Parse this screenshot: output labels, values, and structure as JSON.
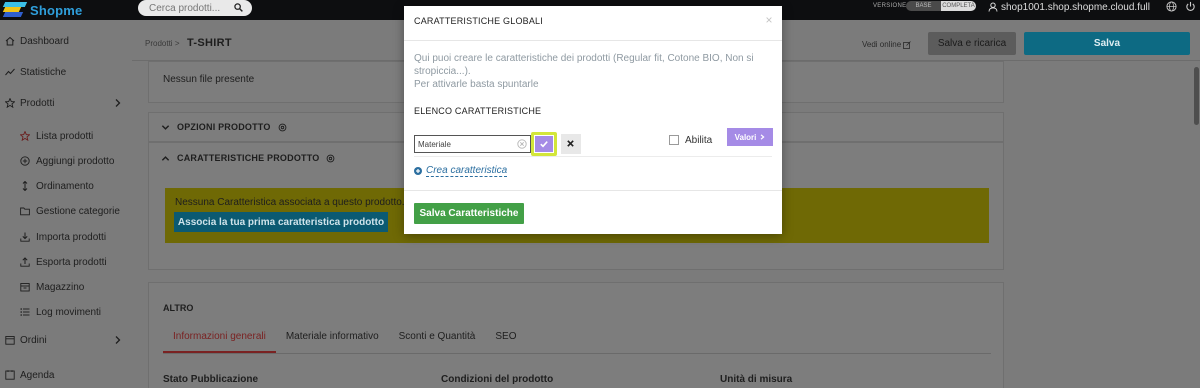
{
  "topbar": {
    "logo_text": "Shopme",
    "search_placeholder": "Cerca prodotti...",
    "version_label": "VERSIONE",
    "version_base": "BASE",
    "version_full": "COMPLETA",
    "shop_domain": "shop1001.shop.shopme.cloud.full"
  },
  "sidebar": {
    "items": [
      {
        "label": "Dashboard",
        "icon": "home-icon"
      },
      {
        "label": "Statistiche",
        "icon": "chart-line-icon"
      },
      {
        "label": "Prodotti",
        "icon": "star-icon",
        "expanded": true
      },
      {
        "label": "Lista prodotti",
        "icon": "star-outline-icon",
        "active": true
      },
      {
        "label": "Aggiungi prodotto",
        "icon": "plus-circle-icon"
      },
      {
        "label": "Ordinamento",
        "icon": "sort-arrows-icon"
      },
      {
        "label": "Gestione categorie",
        "icon": "folder-icon"
      },
      {
        "label": "Importa prodotti",
        "icon": "download-icon"
      },
      {
        "label": "Esporta prodotti",
        "icon": "upload-icon"
      },
      {
        "label": "Magazzino",
        "icon": "warehouse-icon"
      },
      {
        "label": "Log movimenti",
        "icon": "list-icon"
      },
      {
        "label": "Ordini",
        "icon": "calendar-icon"
      },
      {
        "label": "Agenda",
        "icon": "agenda-icon"
      }
    ]
  },
  "header": {
    "breadcrumb_root": "Prodotti",
    "breadcrumb_sep": ">",
    "title": "T-SHIRT",
    "view_online": "Vedi online",
    "save_reload": "Salva e ricarica",
    "save": "Salva"
  },
  "content": {
    "no_files": "Nessun file presente",
    "options_section": "OPZIONI PRODOTTO",
    "features_section": "CARATTERISTICHE PRODOTTO",
    "no_features_text": "Nessuna Caratteristica associata a questo prodotto.",
    "associate_button": "Associa la tua prima caratteristica prodotto",
    "other_title": "ALTRO",
    "tabs": [
      "Informazioni generali",
      "Materiale informativo",
      "Sconti e Quantità",
      "SEO"
    ],
    "field_labels": [
      "Stato Pubblicazione",
      "Condizioni del prodotto",
      "Unità di misura"
    ]
  },
  "modal": {
    "title": "CARATTERISTICHE GLOBALI",
    "close": "×",
    "desc_line1": "Qui puoi creare le caratteristiche dei prodotti (Regular fit, Cotone BIO, Non si stropiccia...).",
    "desc_line2": "Per attivarle basta spuntarle",
    "list_title": "ELENCO CARATTERISTICHE",
    "feature_value": "Materiale",
    "enable_label": "Abilita",
    "values_button": "Valori",
    "create_link": "Crea caratteristica",
    "save_button": "Salva Caratteristiche"
  },
  "colors": {
    "accent_blue": "#0d6a83",
    "confirm_purple": "#a58be6",
    "confirm_highlight": "#d3e63a",
    "save_green": "#43a047",
    "alert_yellow": "#6f6905"
  }
}
